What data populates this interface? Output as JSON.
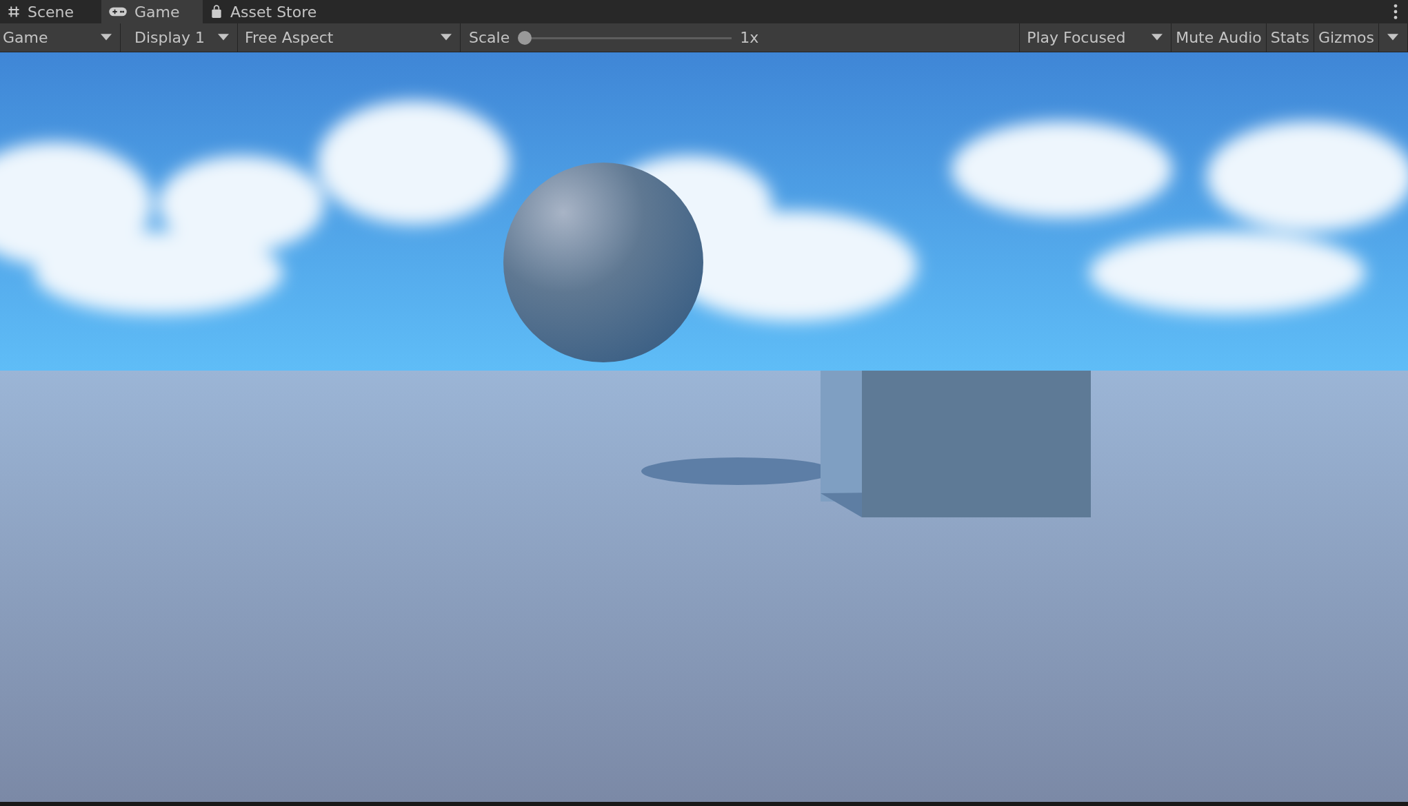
{
  "tabs": [
    {
      "label": "Scene",
      "selected": false
    },
    {
      "label": "Game",
      "selected": true
    },
    {
      "label": "Asset Store",
      "selected": false
    }
  ],
  "toolbar": {
    "view_dropdown": "Game",
    "display_dropdown": "Display 1",
    "aspect_dropdown": "Free Aspect",
    "scale": {
      "label": "Scale",
      "level": 0,
      "reading": "1x"
    },
    "play_mode_dropdown": "Play Focused",
    "toggles": [
      "Mute Audio",
      "Stats",
      "Gizmos"
    ]
  }
}
